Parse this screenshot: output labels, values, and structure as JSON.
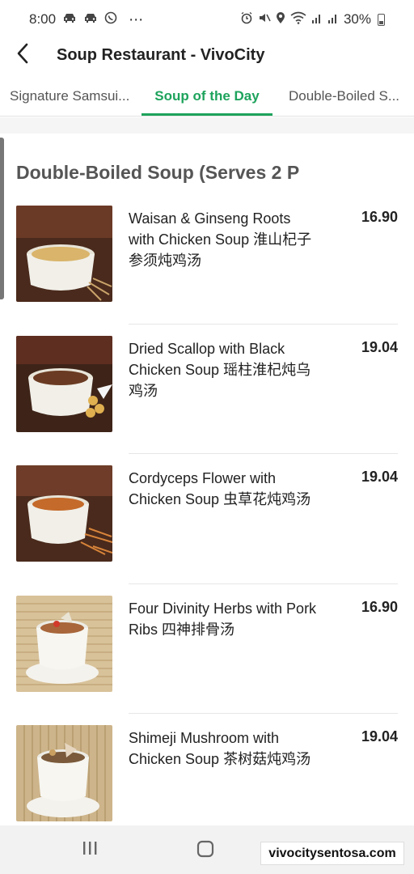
{
  "status_bar": {
    "time": "8:00",
    "dots": "⋯",
    "battery_percent": "30%"
  },
  "header": {
    "title": "Soup Restaurant - VivoCity"
  },
  "tabs": [
    {
      "label": "Signature Samsui...",
      "active": false
    },
    {
      "label": "Soup of the Day",
      "active": true
    },
    {
      "label": "Double-Boiled S...",
      "active": false
    }
  ],
  "section": {
    "title": "Double-Boiled Soup (Serves 2 P"
  },
  "items": [
    {
      "name": "Waisan & Ginseng Roots with Chicken Soup 淮山杞子参须炖鸡汤",
      "price": "16.90"
    },
    {
      "name": "Dried Scallop with Black Chicken Soup 瑶柱淮杞炖乌鸡汤",
      "price": "19.04"
    },
    {
      "name": "Cordyceps Flower with Chicken Soup 虫草花炖鸡汤",
      "price": "19.04"
    },
    {
      "name": "Four Divinity Herbs with Pork Ribs 四神排骨汤",
      "price": "16.90"
    },
    {
      "name": "Shimeji Mushroom with Chicken Soup 茶树菇炖鸡汤",
      "price": "19.04"
    }
  ],
  "watermark": "vivocitysentosa.com",
  "colors": {
    "accent": "#1ea35c",
    "text": "#222222",
    "muted": "#555555"
  }
}
